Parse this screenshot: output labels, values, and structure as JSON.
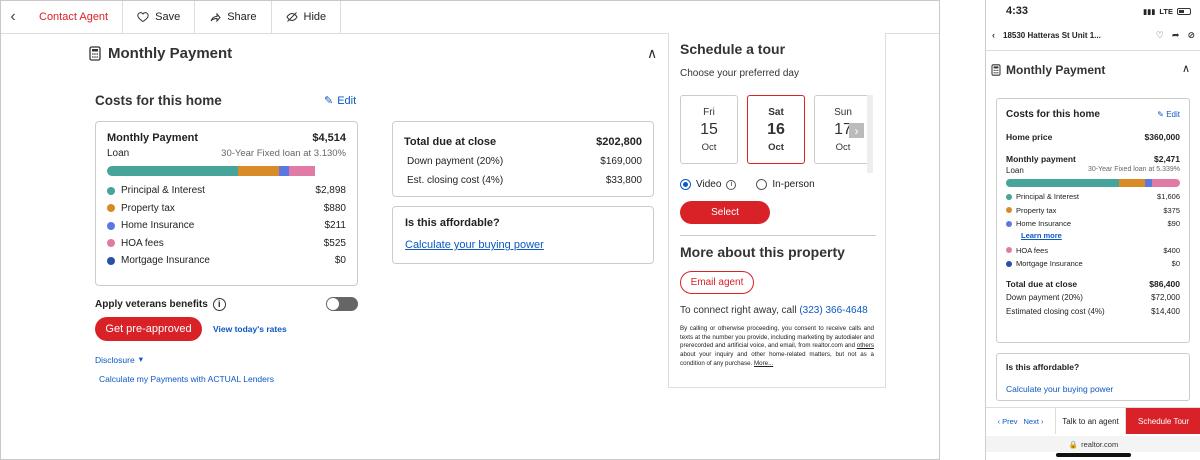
{
  "colors": {
    "pi": "#46a49a",
    "tax": "#d98b28",
    "ins": "#5a78e0",
    "hoa": "#e07ba6",
    "mi": "#2a4fa8",
    "accent": "#d92228",
    "link": "#0b59c3"
  },
  "desktop": {
    "topbar": {
      "contact": "Contact Agent",
      "save": "Save",
      "share": "Share",
      "hide": "Hide"
    },
    "section_title": "Monthly Payment",
    "costs_title": "Costs for this home",
    "edit": "Edit",
    "monthly": {
      "label": "Monthly Payment",
      "total": "$4,514",
      "loan_label": "Loan",
      "loan_desc": "30-Year Fixed loan at 3.130%",
      "bar": [
        0.55,
        0.17,
        0.04,
        0.11,
        0.0
      ],
      "items": [
        {
          "label": "Principal & Interest",
          "value": "$2,898"
        },
        {
          "label": "Property tax",
          "value": "$880"
        },
        {
          "label": "Home Insurance",
          "value": "$211"
        },
        {
          "label": "HOA fees",
          "value": "$525"
        },
        {
          "label": "Mortgage Insurance",
          "value": "$0"
        }
      ]
    },
    "veterans": "Apply veterans benefits",
    "preapproved": "Get pre-approved",
    "rates": "View today's rates",
    "disclosure": "Disclosure",
    "actual": "Calculate my Payments with ACTUAL Lenders",
    "close": {
      "label": "Total due at close",
      "total": "$202,800",
      "rows": [
        {
          "label": "Down payment (20%)",
          "value": "$169,000"
        },
        {
          "label": "Est. closing cost (4%)",
          "value": "$33,800"
        }
      ]
    },
    "afford": {
      "question": "Is this affordable?",
      "link": "Calculate your buying power"
    },
    "tour": {
      "title": "Schedule a tour",
      "pref": "Choose your preferred day",
      "days": [
        {
          "dow": "Fri",
          "num": "15",
          "mon": "Oct"
        },
        {
          "dow": "Sat",
          "num": "16",
          "mon": "Oct"
        },
        {
          "dow": "Sun",
          "num": "17",
          "mon": "Oct"
        }
      ],
      "video": "Video",
      "inperson": "In-person",
      "select": "Select",
      "more_title": "More about this property",
      "email": "Email agent",
      "connect": "To connect right away, call",
      "phone": "(323) 366-4648",
      "legal_a": "By calling or otherwise proceeding, you consent to receive calls and texts at the number you provide, including marketing by autodialer and prerecorded and artificial voice, and email, from realtor.com and",
      "legal_others": "others",
      "legal_b": "about your inquiry and other home-related matters, but not as a condition of any purchase.",
      "legal_more": "More..."
    }
  },
  "phone": {
    "time": "4:33",
    "network": "LTE",
    "address": "18530 Hatteras St Unit 1...",
    "section_title": "Monthly Payment",
    "costs_title": "Costs for this home",
    "edit": "Edit",
    "home_price_label": "Home price",
    "home_price": "$360,000",
    "monthly_label": "Monthly payment",
    "monthly": "$2,471",
    "loan_label": "Loan",
    "loan_desc": "30-Year Fixed loan at 5.339%",
    "bar": [
      0.65,
      0.15,
      0.04,
      0.16,
      0.0
    ],
    "items": [
      {
        "label": "Principal & Interest",
        "value": "$1,606"
      },
      {
        "label": "Property tax",
        "value": "$375"
      },
      {
        "label": "Home Insurance",
        "value": "$90"
      },
      {
        "label": "HOA fees",
        "value": "$400"
      },
      {
        "label": "Mortgage Insurance",
        "value": "$0"
      }
    ],
    "learn_more": "Learn more",
    "close_label": "Total due at close",
    "close_total": "$86,400",
    "close_rows": [
      {
        "label": "Down payment (20%)",
        "value": "$72,000"
      },
      {
        "label": "Estimated closing cost (4%)",
        "value": "$14,400"
      }
    ],
    "afford_q": "Is this affordable?",
    "afford_link": "Calculate your buying power",
    "prev": "Prev",
    "next": "Next",
    "talk": "Talk to an agent",
    "schedule": "Schedule Tour",
    "url": "realtor.com"
  }
}
